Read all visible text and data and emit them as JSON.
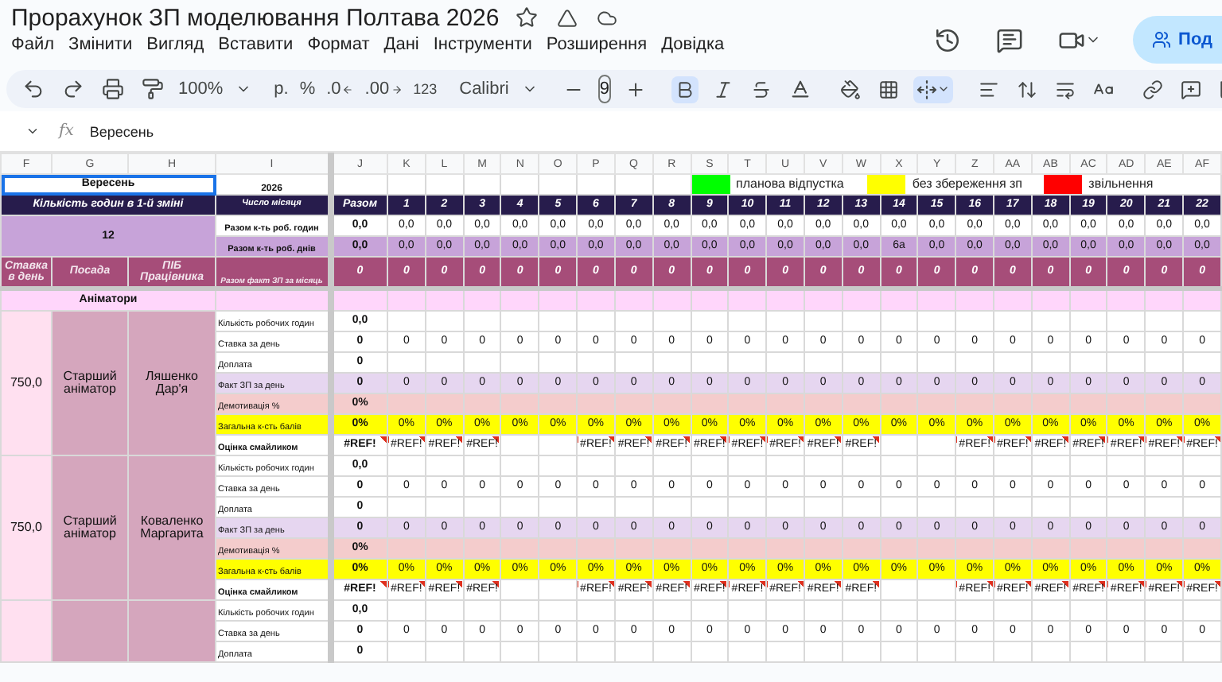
{
  "document": {
    "title": "Прорахунок ЗП моделювання Полтава 2026",
    "starred": false
  },
  "menu": [
    "Файл",
    "Змінити",
    "Вигляд",
    "Вставити",
    "Формат",
    "Дані",
    "Інструменти",
    "Розширення",
    "Довідка"
  ],
  "toolbar": {
    "zoom": "100%",
    "currency": "р.",
    "percent": "%",
    "decrease_decimals": ".0",
    "increase_decimals": ".00",
    "number_format": "123",
    "font": "Calibri",
    "font_size": "9",
    "bold": true,
    "merge_active": true
  },
  "share_button": "Под",
  "formula_bar": {
    "fx": "fx",
    "value": "Вересень"
  },
  "columns": [
    "F",
    "G",
    "H",
    "I",
    "J",
    "K",
    "L",
    "M",
    "N",
    "O",
    "P",
    "Q",
    "R",
    "S",
    "T",
    "U",
    "V",
    "W",
    "X",
    "Y",
    "Z",
    "AA",
    "AB",
    "AC",
    "AD",
    "AE",
    "AF"
  ],
  "sheet": {
    "month": {
      "text": "Вересень",
      "selected": true
    },
    "year": "2026",
    "legend": [
      {
        "color": "#00ff00",
        "label": "планова відпустка"
      },
      {
        "color": "#ffff00",
        "label": "без збереження зп"
      },
      {
        "color": "#ff0000",
        "label": "звільнення"
      }
    ],
    "shift_hours_label": "Кількість годин в 1-й зміні",
    "day_of_month_label": "Число місяця",
    "total_label": "Разом",
    "days": [
      "1",
      "2",
      "3",
      "4",
      "5",
      "6",
      "7",
      "8",
      "9",
      "10",
      "11",
      "12",
      "13",
      "14",
      "15",
      "16",
      "17",
      "18",
      "19",
      "20",
      "21",
      "22"
    ],
    "shift_hours": "12",
    "summary_rows": [
      {
        "label": "Разом к-ть роб.  годин",
        "kind": "plain",
        "total": "0,0",
        "values": [
          "0,0",
          "0,0",
          "0,0",
          "0,0",
          "0,0",
          "0,0",
          "0,0",
          "0,0",
          "0,0",
          "0,0",
          "0,0",
          "0,0",
          "0,0",
          "0,0",
          "0,0",
          "0,0",
          "0,0",
          "0,0",
          "0,0",
          "0,0",
          "0,0",
          "0,0"
        ]
      },
      {
        "label": "Разом к-ть роб.  днів",
        "kind": "lilac",
        "total": "0,0",
        "values": [
          "0,0",
          "0,0",
          "0,0",
          "0,0",
          "0,0",
          "0,0",
          "0,0",
          "0,0",
          "0,0",
          "0,0",
          "0,0",
          "0,0",
          "0,0",
          "6а",
          "0,0",
          "0,0",
          "0,0",
          "0,0",
          "0,0",
          "0,0",
          "0,0",
          "0,0"
        ]
      }
    ],
    "column_headers": [
      "Ставка в день",
      "Посада",
      "ПІБ Працівника"
    ],
    "pay_row": {
      "label": "Разом факт ЗП за місяць",
      "total": "0",
      "values": [
        "0",
        "0",
        "0",
        "0",
        "0",
        "0",
        "0",
        "0",
        "0",
        "0",
        "0",
        "0",
        "0",
        "0",
        "0",
        "0",
        "0",
        "0",
        "0",
        "0",
        "0",
        "0"
      ]
    },
    "section": "Аніматори",
    "employees": [
      {
        "rate": "750,0",
        "position": "Старший аніматор",
        "name": "Ляшенко Дар'я",
        "rows": [
          {
            "kind": "hours",
            "label": "Кількість робочих годин",
            "total": "0,0"
          },
          {
            "kind": "rate",
            "label": "Ставка за день",
            "total": "0",
            "values": [
              "0",
              "0",
              "0",
              "0",
              "0",
              "0",
              "0",
              "0",
              "0",
              "0",
              "0",
              "0",
              "0",
              "0",
              "0",
              "0",
              "0",
              "0",
              "0",
              "0",
              "0",
              "0"
            ]
          },
          {
            "kind": "bonus",
            "label": "Доплата",
            "total": "0"
          },
          {
            "kind": "fact",
            "label": "Факт ЗП за день",
            "total": "0",
            "values": [
              "0",
              "0",
              "0",
              "0",
              "0",
              "0",
              "0",
              "0",
              "0",
              "0",
              "0",
              "0",
              "0",
              "0",
              "0",
              "0",
              "0",
              "0",
              "0",
              "0",
              "0",
              "0"
            ]
          },
          {
            "kind": "demotivation",
            "label": "Демотивація %",
            "total": "0%"
          },
          {
            "kind": "score",
            "label": "Загальна к-сть балів",
            "total": "0%",
            "values": [
              "0%",
              "0%",
              "0%",
              "0%",
              "0%",
              "0%",
              "0%",
              "0%",
              "0%",
              "0%",
              "0%",
              "0%",
              "0%",
              "0%",
              "0%",
              "0%",
              "0%",
              "0%",
              "0%",
              "0%",
              "0%",
              "0%"
            ]
          },
          {
            "kind": "smiley",
            "label": "Оцінка смайликом",
            "total": "#REF!",
            "cells": [
              {
                "text": "#REF!"
              },
              {
                "text": "#REF!"
              },
              {
                "text": "#REF!"
              },
              {},
              {},
              {
                "text": "#REF!"
              },
              {
                "text": "#REF!"
              },
              {
                "text": "#REF!"
              },
              {
                "text": "#REF!"
              },
              {
                "text": "#REF!"
              },
              {
                "text": "#REF!"
              },
              {
                "text": "#REF!"
              },
              {
                "text": "#REF!"
              },
              {},
              {},
              {
                "text": "#REF!"
              },
              {
                "text": "#REF!"
              },
              {
                "text": "#REF!"
              },
              {
                "text": "#REF!"
              },
              {
                "text": "#REF!"
              },
              {
                "text": "#REF!"
              },
              {
                "text": "#REF!"
              }
            ]
          }
        ]
      },
      {
        "rate": "750,0",
        "position": "Старший аніматор",
        "name": "Коваленко Маргарита",
        "rows": [
          {
            "kind": "hours",
            "label": "Кількість робочих годин",
            "total": "0,0"
          },
          {
            "kind": "rate",
            "label": "Ставка за день",
            "total": "0",
            "values": [
              "0",
              "0",
              "0",
              "0",
              "0",
              "0",
              "0",
              "0",
              "0",
              "0",
              "0",
              "0",
              "0",
              "0",
              "0",
              "0",
              "0",
              "0",
              "0",
              "0",
              "0",
              "0"
            ]
          },
          {
            "kind": "bonus",
            "label": "Доплата",
            "total": "0"
          },
          {
            "kind": "fact",
            "label": "Факт ЗП за день",
            "total": "0",
            "values": [
              "0",
              "0",
              "0",
              "0",
              "0",
              "0",
              "0",
              "0",
              "0",
              "0",
              "0",
              "0",
              "0",
              "0",
              "0",
              "0",
              "0",
              "0",
              "0",
              "0",
              "0",
              "0"
            ]
          },
          {
            "kind": "demotivation",
            "label": "Демотивація %",
            "total": "0%"
          },
          {
            "kind": "score",
            "label": "Загальна к-сть балів",
            "total": "0%",
            "values": [
              "0%",
              "0%",
              "0%",
              "0%",
              "0%",
              "0%",
              "0%",
              "0%",
              "0%",
              "0%",
              "0%",
              "0%",
              "0%",
              "0%",
              "0%",
              "0%",
              "0%",
              "0%",
              "0%",
              "0%",
              "0%",
              "0%"
            ]
          },
          {
            "kind": "smiley",
            "label": "Оцінка смайликом",
            "total": "#REF!",
            "cells": [
              {
                "text": "#REF!"
              },
              {
                "text": "#REF!"
              },
              {
                "text": "#REF!"
              },
              {},
              {},
              {
                "text": "#REF!"
              },
              {
                "text": "#REF!"
              },
              {
                "text": "#REF!"
              },
              {
                "text": "#REF!"
              },
              {
                "text": "#REF!"
              },
              {
                "text": "#REF!"
              },
              {
                "text": "#REF!"
              },
              {
                "text": "#REF!"
              },
              {},
              {},
              {
                "text": "#REF!"
              },
              {
                "text": "#REF!"
              },
              {
                "text": "#REF!"
              },
              {
                "text": "#REF!"
              },
              {
                "text": "#REF!"
              },
              {
                "text": "#REF!"
              },
              {
                "text": "#REF!"
              }
            ]
          }
        ]
      },
      {
        "rows": [
          {
            "kind": "hours",
            "label": "Кількість робочих годин",
            "total": "0,0"
          },
          {
            "kind": "rate",
            "label": "Ставка за день",
            "total": "0",
            "values": [
              "0",
              "0",
              "0",
              "0",
              "0",
              "0",
              "0",
              "0",
              "0",
              "0",
              "0",
              "0",
              "0",
              "0",
              "0",
              "0",
              "0",
              "0",
              "0",
              "0",
              "0",
              "0"
            ]
          },
          {
            "kind": "bonus",
            "label": "Доплата",
            "total": "0"
          }
        ]
      }
    ]
  }
}
